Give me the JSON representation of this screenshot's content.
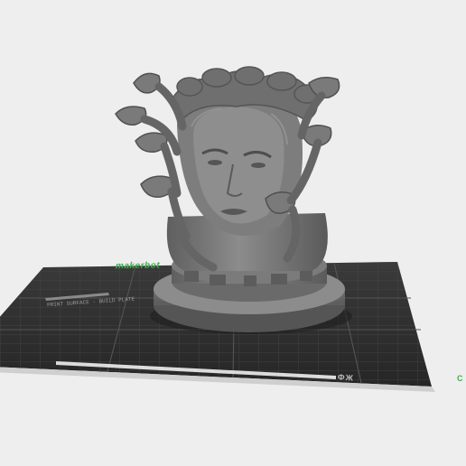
{
  "scene": {
    "background_color": "#eeeeee",
    "model_color": "#6f6f6f",
    "plate_color": "#2e2e2e",
    "plate_accent_color": "#3fb04f"
  },
  "build_plate": {
    "brand_label": "makerbot",
    "strip_text": "PRINT SURFACE · BUILD PLATE",
    "corner_label": "ФЖ",
    "edge_mark": "C"
  },
  "model": {
    "icon": "medusa-head-3d-model"
  }
}
